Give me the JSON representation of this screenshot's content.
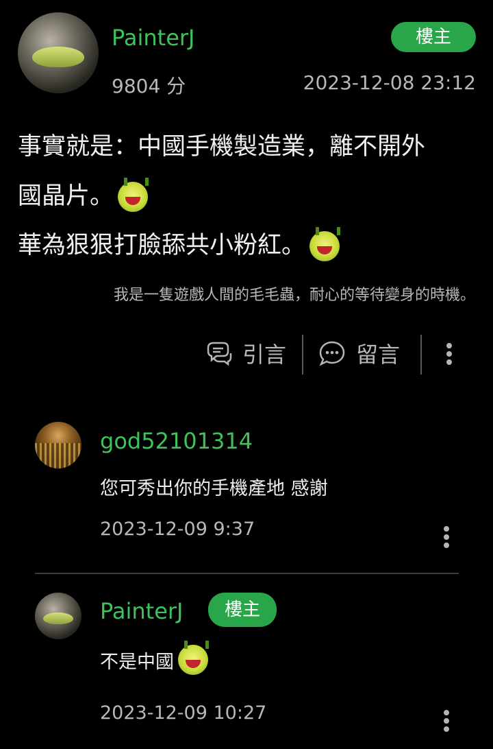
{
  "post": {
    "author": "PainterJ",
    "badge": "樓主",
    "score": "9804 分",
    "timestamp": "2023-12-08 23:12",
    "content_line1": "事實就是：中國手機製造業，離不開外",
    "content_line2": "國晶片。",
    "content_line3": "華為狠狠打臉舔共小粉紅。",
    "signature": "我是一隻遊戲人間的毛毛蟲，耐心的等待變身的時機。",
    "actions": {
      "quote_label": "引言",
      "comment_label": "留言"
    }
  },
  "replies": [
    {
      "author": "god52101314",
      "text": "您可秀出你的手機產地 感謝",
      "timestamp": "2023-12-09 9:37"
    },
    {
      "author": "PainterJ",
      "badge": "樓主",
      "text": "不是中國",
      "timestamp": "2023-12-09 10:27"
    }
  ],
  "colors": {
    "accent_green": "#3fc25b",
    "badge_bg": "#2aa64a",
    "background": "#000000"
  },
  "icons": {
    "emoji": "grinning-devil-emoji",
    "quote": "quote-bubbles-icon",
    "comment": "comment-bubble-icon",
    "more": "more-vertical-icon"
  }
}
